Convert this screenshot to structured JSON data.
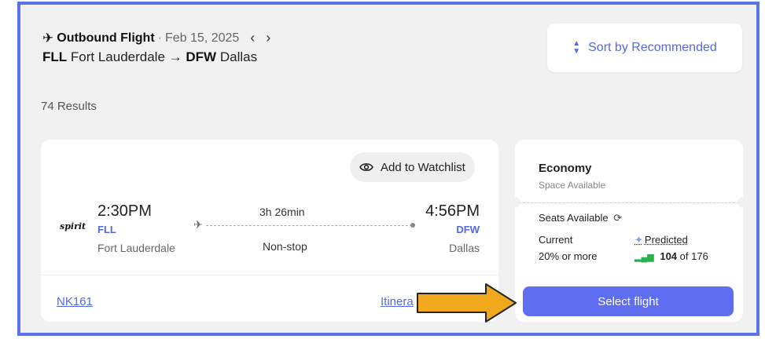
{
  "header": {
    "label": "Outbound Flight",
    "separator": "·",
    "date": "Feb 15, 2025",
    "prev": "‹",
    "next": "›",
    "origin_code": "FLL",
    "origin_city": "Fort Lauderdale",
    "arrow": "→",
    "dest_code": "DFW",
    "dest_city": "Dallas"
  },
  "sort": {
    "icon": "sort-icon",
    "label": "Sort by Recommended"
  },
  "results": "74 Results",
  "flight": {
    "watchlist_label": "Add to Watchlist",
    "airline": "spirit",
    "departure_time": "2:30PM",
    "departure_code": "FLL",
    "departure_city": "Fort Lauderdale",
    "duration": "3h 26min",
    "stops": "Non-stop",
    "arrival_time": "4:56PM",
    "arrival_code": "DFW",
    "arrival_city": "Dallas",
    "flight_number": "NK161",
    "itinerary_link": "Itinera"
  },
  "fare": {
    "class": "Economy",
    "availability": "Space Available",
    "seats_label": "Seats Available",
    "current_label": "Current",
    "current_value": "20% or more",
    "predicted_label": "Predicted",
    "predicted_seats": "104",
    "predicted_total": "of 176",
    "select_label": "Select flight"
  },
  "colors": {
    "accent": "#5369e0",
    "button": "#5f6ef0",
    "frame": "#5a74e8",
    "annotation_arrow": "#f0a81c",
    "bars_green": "#2bb24c"
  }
}
